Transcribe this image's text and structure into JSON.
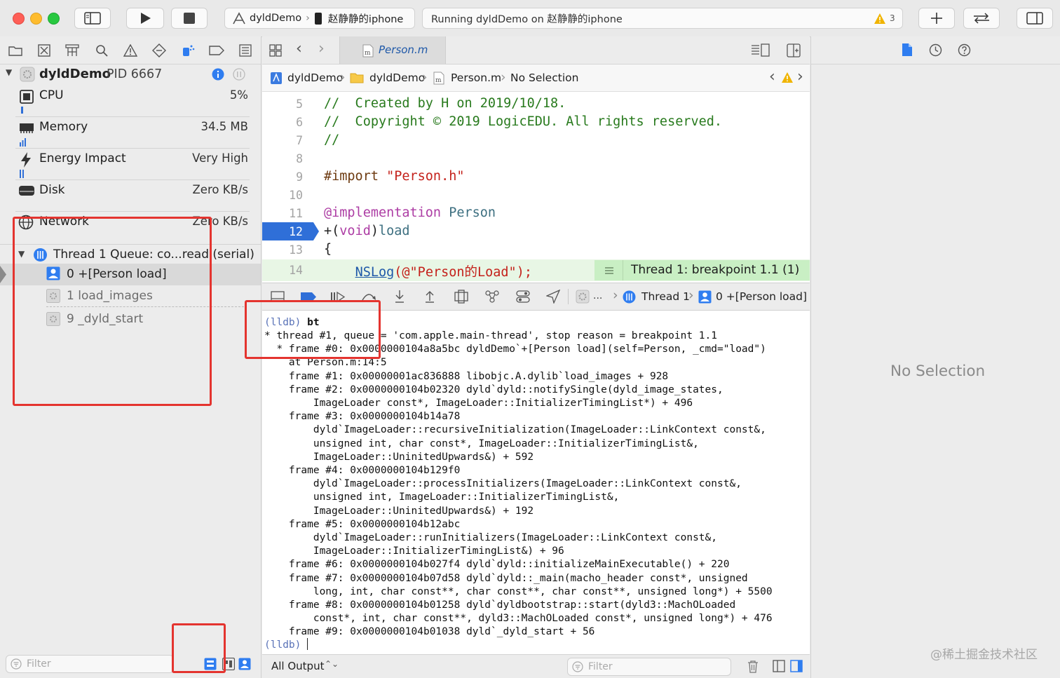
{
  "toolbar": {
    "scheme_project": "dyldDemo",
    "scheme_device": "赵静静的iphone",
    "status_text": "Running dyldDemo on 赵静静的iphone",
    "warning_count": "3"
  },
  "navigator": {
    "process_name": "dyldDemo",
    "process_pid": "PID 6667",
    "gauges": [
      {
        "label": "CPU",
        "value": "5%"
      },
      {
        "label": "Memory",
        "value": "34.5 MB"
      },
      {
        "label": "Energy Impact",
        "value": "Very High"
      },
      {
        "label": "Disk",
        "value": "Zero KB/s"
      },
      {
        "label": "Network",
        "value": "Zero KB/s"
      }
    ],
    "thread_label": "Thread 1 Queue: co...read (serial)",
    "frames": [
      {
        "label": "0 +[Person load]"
      },
      {
        "label": "1 load_images"
      },
      {
        "label": "9 _dyld_start"
      }
    ],
    "filter_placeholder": "Filter"
  },
  "editor": {
    "tab_name": "Person.m",
    "breadcrumbs": [
      "dyldDemo",
      "dyldDemo",
      "Person.m",
      "No Selection"
    ],
    "lines": [
      {
        "num": "5",
        "text": "//  Created by H on 2019/10/18."
      },
      {
        "num": "6",
        "text": "//  Copyright © 2019 LogicEDU. All rights reserved."
      },
      {
        "num": "7",
        "text": "//"
      },
      {
        "num": "8",
        "text": ""
      },
      {
        "num": "9",
        "text_a": "#import ",
        "text_b": "\"Person.h\""
      },
      {
        "num": "10",
        "text": ""
      },
      {
        "num": "11",
        "text_a": "@implementation",
        "text_b": " Person"
      },
      {
        "num": "12",
        "text_a": "+(",
        "text_b": "void",
        "text_c": ")",
        "text_d": "load"
      },
      {
        "num": "13",
        "text": "{"
      },
      {
        "num": "14",
        "text_a": "    ",
        "text_b": "NSLog",
        "text_c": "(@\"Person的Load\");"
      }
    ],
    "breakpoint_label": "Thread 1: breakpoint 1.1 (1)"
  },
  "debugbar": {
    "thread": "Thread 1",
    "frame": "0 +[Person load]",
    "ellipsis": "..."
  },
  "console": {
    "prompt": "(lldb)",
    "command": "bt",
    "lines": [
      "* thread #1, queue = 'com.apple.main-thread', stop reason = breakpoint 1.1",
      "  * frame #0: 0x0000000104a8a5bc dyldDemo`+[Person load](self=Person, _cmd=\"load\")",
      "    at Person.m:14:5",
      "    frame #1: 0x00000001ac836888 libobjc.A.dylib`load_images + 928",
      "    frame #2: 0x0000000104b02320 dyld`dyld::notifySingle(dyld_image_states,",
      "        ImageLoader const*, ImageLoader::InitializerTimingList*) + 496",
      "    frame #3: 0x0000000104b14a78",
      "        dyld`ImageLoader::recursiveInitialization(ImageLoader::LinkContext const&,",
      "        unsigned int, char const*, ImageLoader::InitializerTimingList&,",
      "        ImageLoader::UninitedUpwards&) + 592",
      "    frame #4: 0x0000000104b129f0",
      "        dyld`ImageLoader::processInitializers(ImageLoader::LinkContext const&,",
      "        unsigned int, ImageLoader::InitializerTimingList&,",
      "        ImageLoader::UninitedUpwards&) + 192",
      "    frame #5: 0x0000000104b12abc",
      "        dyld`ImageLoader::runInitializers(ImageLoader::LinkContext const&,",
      "        ImageLoader::InitializerTimingList&) + 96",
      "    frame #6: 0x0000000104b027f4 dyld`dyld::initializeMainExecutable() + 220",
      "    frame #7: 0x0000000104b07d58 dyld`dyld::_main(macho_header const*, unsigned",
      "        long, int, char const**, char const**, char const**, unsigned long*) + 5500",
      "    frame #8: 0x0000000104b01258 dyld`dyldbootstrap::start(dyld3::MachOLoaded",
      "        const*, int, char const**, dyld3::MachOLoaded const*, unsigned long*) + 476",
      "    frame #9: 0x0000000104b01038 dyld`_dyld_start + 56"
    ],
    "output_selector": "All Output",
    "filter_placeholder": "Filter"
  },
  "inspector": {
    "no_selection": "No Selection"
  },
  "watermark": "@稀土掘金技术社区",
  "colors": {
    "accent": "#1f6fe5",
    "breakpoint": "#2f6fd8",
    "breakpoint_banner": "#c9efc4",
    "annotation": "#e4342f",
    "warning": "#f0b400"
  }
}
